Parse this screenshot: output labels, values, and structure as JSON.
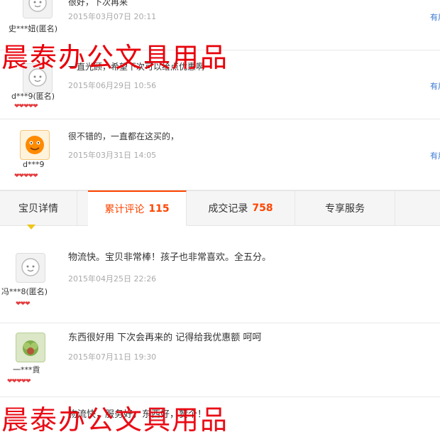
{
  "reviews_top": [
    {
      "user": "史***妞(匿名)",
      "text": "很好，下次再来",
      "time": "2015年03月07日 20:11",
      "useful": "有用",
      "rank": "❤❤❤❤❤"
    },
    {
      "user": "d***9(匿名)",
      "text": "一直光顾，希望下次可以给点优惠啊",
      "time": "2015年06月29日 10:56",
      "useful": "有用",
      "rank": "❤❤❤❤❤"
    },
    {
      "user": "d***9",
      "text": "很不错的，一直都在这买的，",
      "time": "2015年03月31日 14:05",
      "useful": "有用",
      "rank": "❤❤❤❤❤"
    }
  ],
  "tabs": [
    {
      "label": "宝贝详情",
      "count": ""
    },
    {
      "label": "累计评论",
      "count": "115"
    },
    {
      "label": "成交记录",
      "count": "758"
    },
    {
      "label": "专享服务",
      "count": ""
    }
  ],
  "reviews_bottom": [
    {
      "user": "冯***8(匿名)",
      "text": "物流快。宝贝非常棒！孩子也非常喜欢。全五分。",
      "time": "2015年04月25日 22:26",
      "rank": "❤❤❤"
    },
    {
      "user": "一***貢",
      "text": "东西很好用 下次会再来的 记得给我优惠额 呵呵",
      "time": "2015年07月11日 19:30",
      "rank": "❤❤❤❤❤"
    },
    {
      "user": "",
      "text": "物流快，服务好，东西好，赞个！",
      "time": "",
      "rank": ""
    }
  ],
  "watermark": "晨泰办公文具用品",
  "colors": {
    "accent": "#ff4400",
    "watermark": "#e8000a",
    "link": "#3d7bd5"
  }
}
